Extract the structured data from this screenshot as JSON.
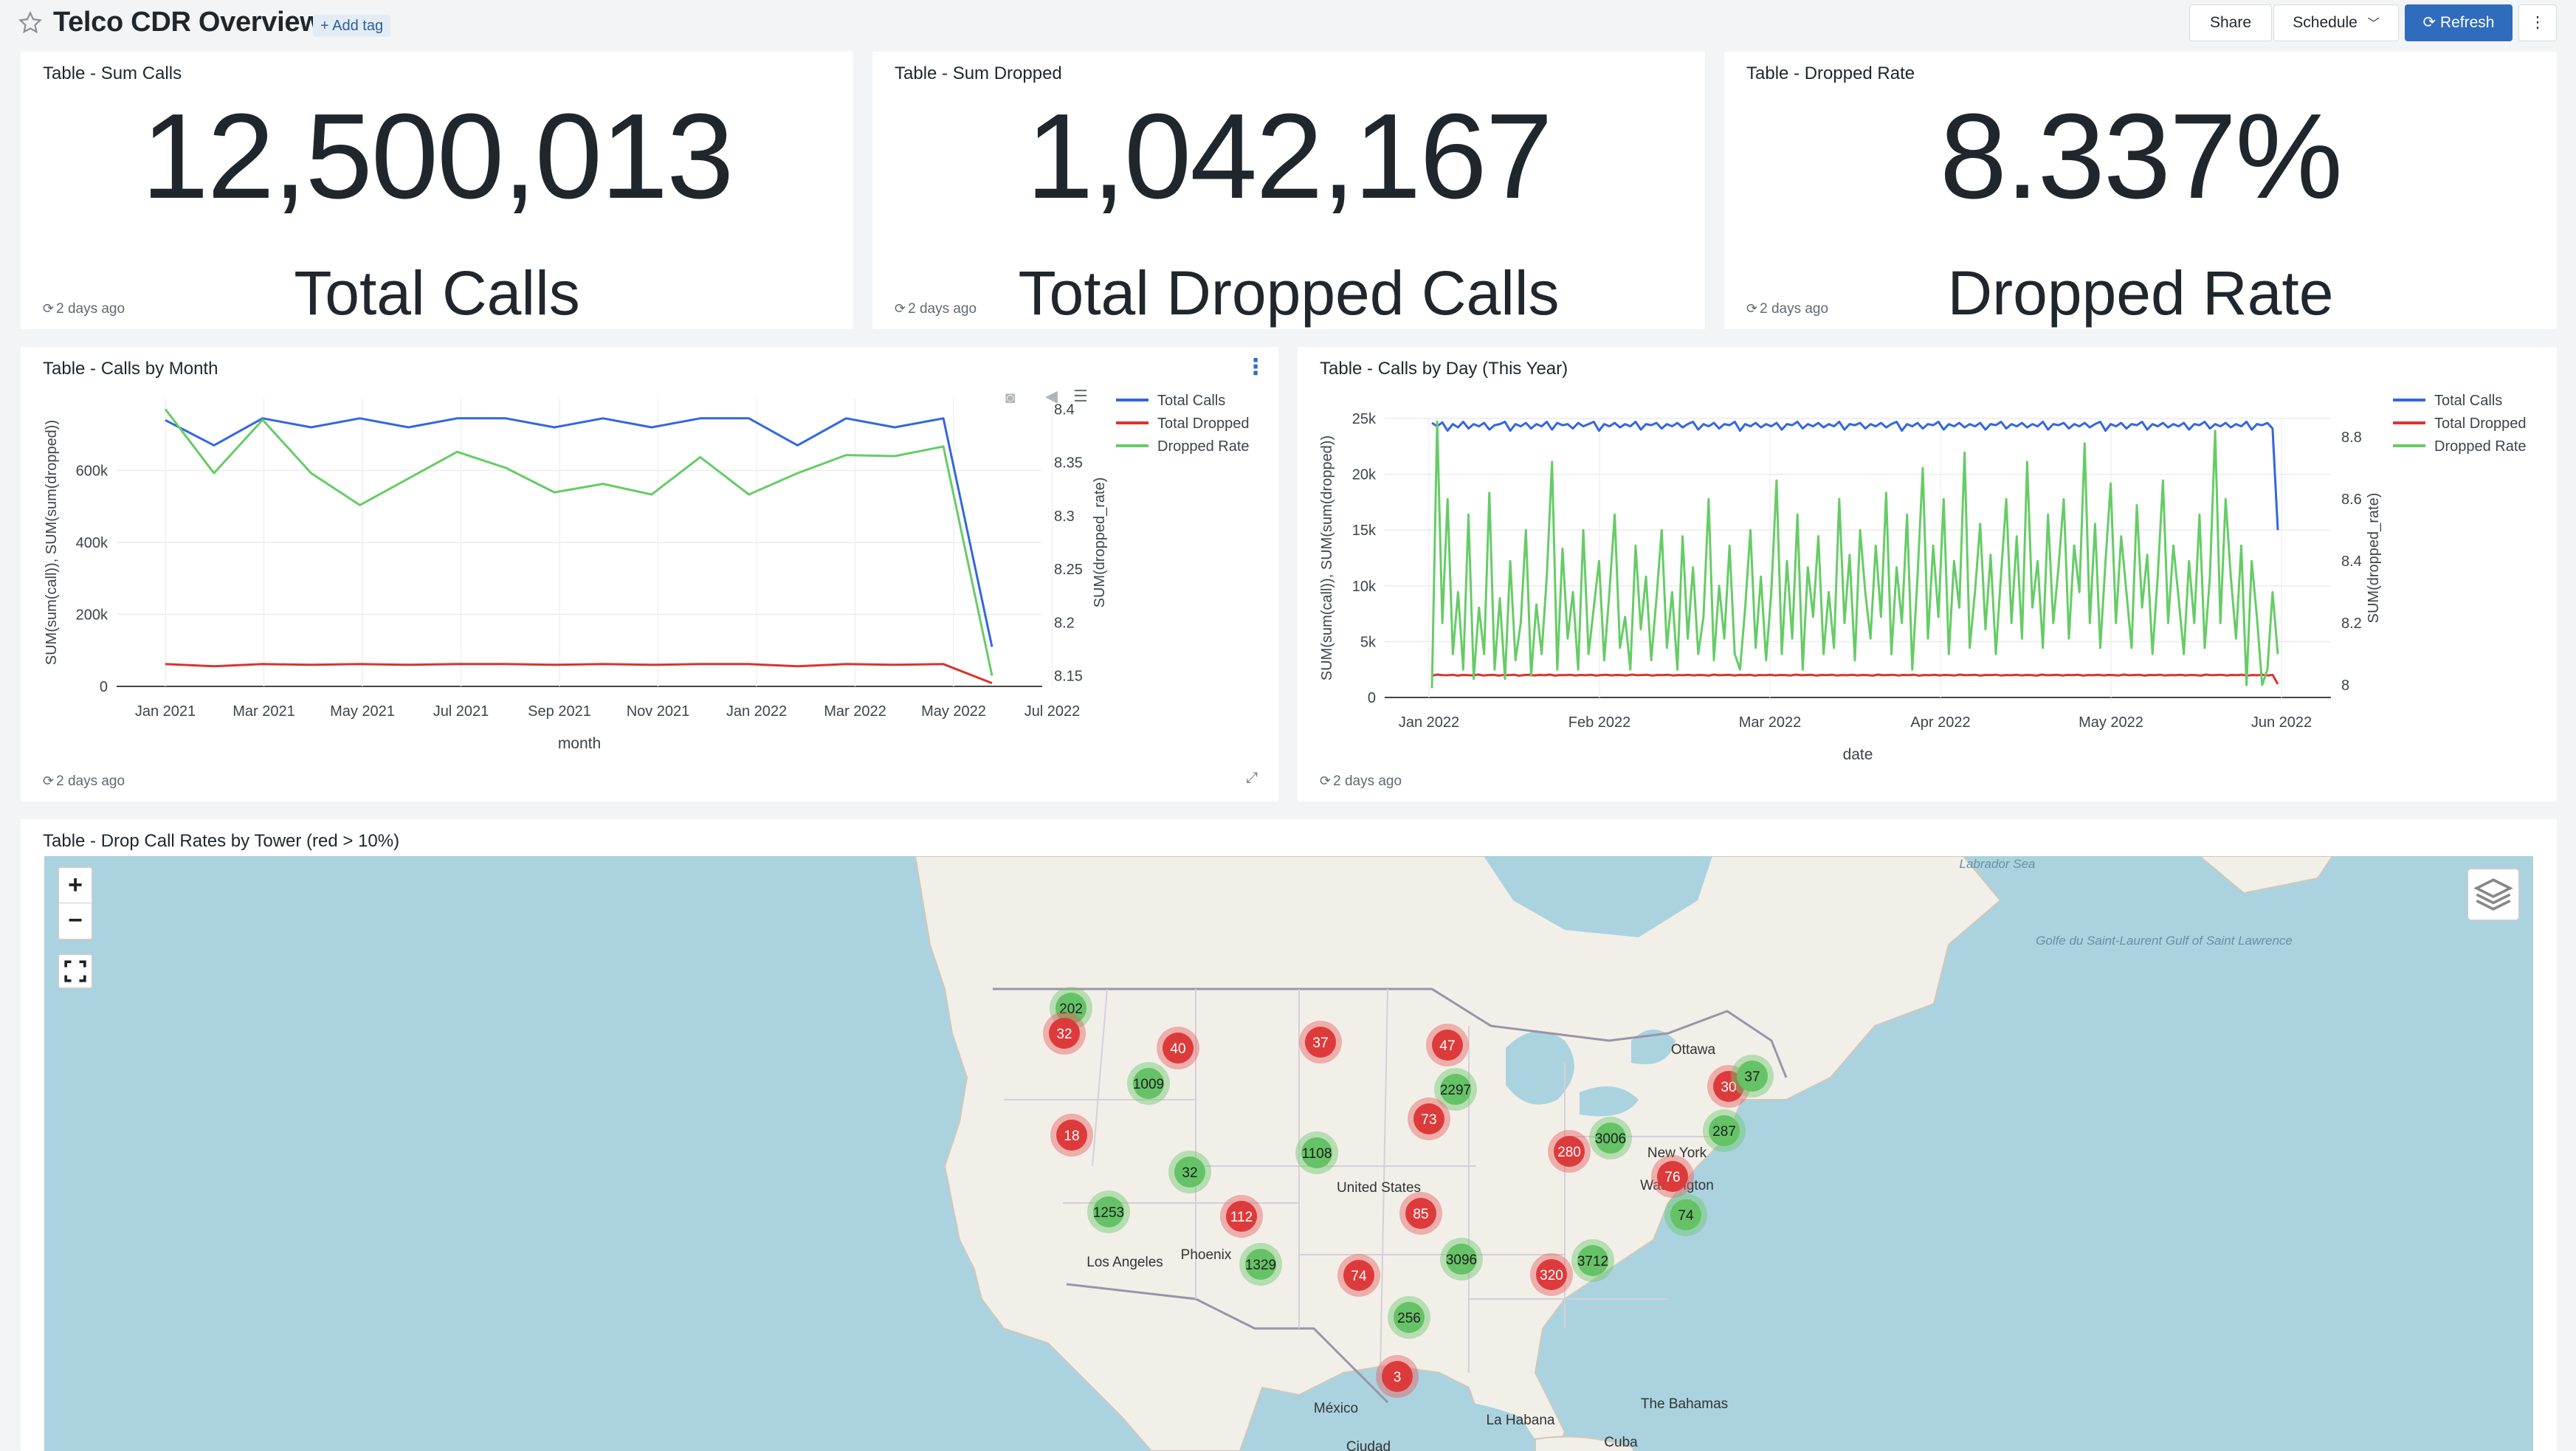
{
  "header": {
    "title": "Telco CDR Overview",
    "add_tag": "+ Add tag",
    "share": "Share",
    "schedule": "Schedule",
    "refresh": "Refresh",
    "more": "⋮"
  },
  "counters": [
    {
      "title": "Table - Sum Calls",
      "value": "12,500,013",
      "label": "Total Calls",
      "updated": "2 days ago"
    },
    {
      "title": "Table - Sum Dropped",
      "value": "1,042,167",
      "label": "Total Dropped Calls",
      "updated": "2 days ago"
    },
    {
      "title": "Table - Dropped Rate",
      "value": "8.337%",
      "label": "Dropped Rate",
      "updated": "2 days ago"
    }
  ],
  "colors": {
    "total_calls": "#3366e0",
    "total_dropped": "#db3330",
    "dropped_rate": "#66cc66",
    "accent": "#2f6cbd"
  },
  "chart_data": [
    {
      "type": "line",
      "title": "Table - Calls by Month",
      "xlabel": "month",
      "ylabel": "SUM(sum(call)), SUM(sum(dropped))",
      "y2label": "SUM(dropped_rate)",
      "updated": "2 days ago",
      "x_ticks": [
        "Jan 2021",
        "Mar 2021",
        "May 2021",
        "Jul 2021",
        "Sep 2021",
        "Nov 2021",
        "Jan 2022",
        "Mar 2022",
        "May 2022",
        "Jul 2022"
      ],
      "y_ticks": [
        "0",
        "200k",
        "400k",
        "600k"
      ],
      "y2_ticks": [
        "8.15",
        "8.2",
        "8.25",
        "8.3",
        "8.35",
        "8.4"
      ],
      "x": [
        "2021-01",
        "2021-02",
        "2021-03",
        "2021-04",
        "2021-05",
        "2021-06",
        "2021-07",
        "2021-08",
        "2021-09",
        "2021-10",
        "2021-11",
        "2021-12",
        "2022-01",
        "2022-02",
        "2022-03",
        "2022-04",
        "2022-05",
        "2022-06"
      ],
      "ylim": [
        0,
        800000
      ],
      "y2lim": [
        8.14,
        8.41
      ],
      "legend_position": "top-right",
      "series": [
        {
          "name": "Total Calls",
          "axis": "y",
          "values": [
            740000,
            670000,
            745000,
            720000,
            745000,
            720000,
            745000,
            745000,
            720000,
            745000,
            720000,
            745000,
            745000,
            670000,
            745000,
            720000,
            745000,
            110000
          ]
        },
        {
          "name": "Total Dropped",
          "axis": "y",
          "values": [
            62000,
            56000,
            62000,
            60000,
            62000,
            60000,
            62000,
            62000,
            60000,
            62000,
            60000,
            62000,
            62000,
            56000,
            62000,
            60000,
            62000,
            9000
          ]
        },
        {
          "name": "Dropped Rate",
          "axis": "y2",
          "values": [
            8.4,
            8.34,
            8.39,
            8.34,
            8.31,
            8.335,
            8.36,
            8.345,
            8.322,
            8.33,
            8.32,
            8.355,
            8.32,
            8.34,
            8.357,
            8.356,
            8.365,
            8.15
          ]
        }
      ]
    },
    {
      "type": "line",
      "title": "Table - Calls by Day (This Year)",
      "xlabel": "date",
      "ylabel": "SUM(sum(call)), SUM(sum(dropped))",
      "y2label": "SUM(dropped_rate)",
      "updated": "2 days ago",
      "x_ticks": [
        "Jan 2022",
        "Feb 2022",
        "Mar 2022",
        "Apr 2022",
        "May 2022",
        "Jun 2022"
      ],
      "y_ticks": [
        "0",
        "5k",
        "10k",
        "15k",
        "20k",
        "25k"
      ],
      "y2_ticks": [
        "8",
        "8.2",
        "8.4",
        "8.6",
        "8.8"
      ],
      "x_start": "2022-01-01",
      "x_end": "2022-06-09",
      "ylim": [
        0,
        25000
      ],
      "y2lim": [
        7.96,
        8.86
      ],
      "legend_position": "top-right",
      "series": [
        {
          "name": "Total Calls",
          "axis": "y",
          "values": [
            24600,
            24300,
            24650,
            23900,
            24500,
            24200,
            24700,
            24100,
            24500,
            24300,
            24600,
            24000,
            24400,
            24500,
            24700,
            23900,
            24500,
            24300,
            24600,
            24100,
            24500,
            24300,
            24700,
            24000,
            24600,
            24400,
            24500,
            24100,
            24600,
            24300,
            24500,
            24700,
            23900,
            24500,
            24300,
            24600,
            24200,
            24500,
            24300,
            24700,
            24000,
            24500,
            24400,
            24600,
            24100,
            24500,
            24300,
            24600,
            24200,
            24500,
            24700,
            24000,
            24500,
            24300,
            24600,
            24100,
            24500,
            24400,
            24700,
            23900,
            24500,
            24300,
            24600,
            24200,
            24500,
            24300,
            24600,
            24000,
            24500,
            24400,
            24700,
            24100,
            24500,
            24300,
            24600,
            24200,
            24500,
            24300,
            24700,
            24000,
            24500,
            24400,
            24600,
            24100,
            24500,
            24300,
            24600,
            24200,
            24500,
            24700,
            23900,
            24500,
            24300,
            24600,
            24100,
            24500,
            24400,
            24700,
            24000,
            24500,
            24300,
            24600,
            24200,
            24500,
            24300,
            24600,
            24000,
            24500,
            24400,
            24700,
            24100,
            24500,
            24300,
            24600,
            24200,
            24500,
            24300,
            24700,
            24000,
            24500,
            24400,
            24600,
            24100,
            24500,
            24300,
            24600,
            24200,
            24500,
            24700,
            23900,
            24500,
            24300,
            24600,
            24100,
            24500,
            24400,
            24700,
            24000,
            24500,
            24300,
            24600,
            24200,
            24500,
            24300,
            24600,
            24000,
            24500,
            24400,
            24700,
            24100,
            24500,
            24300,
            24600,
            24200,
            24500,
            24300,
            24700,
            24000,
            24500,
            24400,
            24600,
            24100,
            15000
          ]
        },
        {
          "name": "Total Dropped",
          "axis": "y",
          "values": [
            1950,
            2050,
            2000,
            1990,
            2040,
            1960,
            2020,
            2000,
            1980,
            2050,
            1970,
            2010,
            2030,
            1960,
            2020,
            2000,
            2040,
            1950,
            2010,
            2030,
            1980,
            2020,
            1990,
            2050,
            1960,
            2010,
            2000,
            2030,
            1970,
            2020,
            1990,
            2040,
            1960,
            2010,
            2030,
            1980,
            2020,
            2000,
            1970,
            2050,
            1990,
            2010,
            2030,
            1960,
            2020,
            2000,
            2040,
            1970,
            2010,
            1990,
            2030,
            1980,
            2020,
            2000,
            1960,
            2050,
            1990,
            2010,
            2030,
            1970,
            2020,
            2000,
            2040,
            1960,
            2010,
            1990,
            2030,
            1980,
            2020,
            2000,
            1970,
            2050,
            1990,
            2010,
            2030,
            1960,
            2020,
            2000,
            2040,
            1970,
            2010,
            1990,
            2030,
            1980,
            2020,
            2000,
            1960,
            2050,
            1990,
            2010,
            2030,
            1970,
            2020,
            2000,
            2040,
            1960,
            2010,
            1990,
            2030,
            1980,
            2020,
            2000,
            1970,
            2050,
            1990,
            2010,
            2030,
            1960,
            2020,
            2000,
            2040,
            1970,
            2010,
            1990,
            2030,
            1980,
            2020,
            2000,
            1960,
            2050,
            1990,
            2010,
            2030,
            1970,
            2020,
            2000,
            2040,
            1960,
            2010,
            1990,
            2030,
            1980,
            2020,
            2000,
            1970,
            2050,
            1990,
            2010,
            2030,
            1960,
            2020,
            2000,
            2040,
            1970,
            2010,
            1990,
            2030,
            1980,
            2020,
            2000,
            1960,
            2050,
            1990,
            2010,
            2030,
            1970,
            2020,
            2000,
            2040,
            1960,
            2010,
            1990,
            2030,
            1980,
            2020,
            1200
          ]
        },
        {
          "name": "Dropped Rate",
          "axis": "y2",
          "values": [
            7.99,
            8.85,
            8.2,
            8.6,
            8.1,
            8.3,
            8.05,
            8.55,
            8.02,
            8.25,
            8.1,
            8.62,
            8.05,
            8.28,
            8.02,
            8.4,
            8.08,
            8.2,
            8.5,
            8.03,
            8.26,
            8.1,
            8.35,
            8.72,
            8.05,
            8.44,
            8.15,
            8.3,
            8.05,
            8.5,
            8.1,
            8.25,
            8.4,
            8.08,
            8.3,
            8.55,
            8.12,
            8.22,
            8.05,
            8.45,
            8.18,
            8.35,
            8.08,
            8.28,
            8.5,
            8.12,
            8.3,
            8.05,
            8.48,
            8.15,
            8.38,
            8.1,
            8.22,
            8.6,
            8.08,
            8.32,
            8.15,
            8.45,
            8.1,
            8.05,
            8.25,
            8.5,
            8.12,
            8.35,
            8.08,
            8.3,
            8.66,
            8.1,
            8.4,
            8.15,
            8.55,
            8.05,
            8.38,
            8.22,
            8.48,
            8.1,
            8.3,
            8.12,
            8.6,
            8.2,
            8.42,
            8.08,
            8.5,
            8.3,
            8.15,
            8.45,
            8.22,
            8.62,
            8.1,
            8.38,
            8.2,
            8.55,
            8.05,
            8.35,
            8.7,
            8.15,
            8.45,
            8.22,
            8.6,
            8.1,
            8.4,
            8.25,
            8.75,
            8.12,
            8.3,
            8.52,
            8.18,
            8.42,
            8.1,
            8.36,
            8.6,
            8.2,
            8.48,
            8.15,
            8.72,
            8.25,
            8.4,
            8.12,
            8.55,
            8.2,
            8.38,
            8.6,
            8.15,
            8.45,
            8.3,
            8.78,
            8.2,
            8.52,
            8.12,
            8.4,
            8.65,
            8.2,
            8.48,
            8.3,
            8.12,
            8.58,
            8.25,
            8.42,
            8.1,
            8.35,
            8.66,
            8.2,
            8.45,
            8.28,
            8.1,
            8.4,
            8.2,
            8.55,
            8.12,
            8.35,
            8.82,
            8.2,
            8.6,
            8.35,
            8.15,
            8.45,
            8.0,
            8.4,
            8.22,
            8.0,
            8.05,
            8.3,
            8.1
          ]
        }
      ]
    }
  ],
  "map": {
    "title": "Table - Drop Call Rates by Tower (red > 10%)",
    "zoom_in": "+",
    "zoom_out": "−",
    "place_labels": [
      "Ottawa",
      "New York",
      "Washington",
      "United States",
      "Los Angeles",
      "Phoenix",
      "México",
      "La Habana",
      "The Bahamas",
      "Cuba",
      "Ciudad",
      "Labrador Sea",
      "Golfe du Saint-Laurent Gulf of Saint Lawrence"
    ],
    "clusters": [
      {
        "count": "202",
        "status": "green"
      },
      {
        "count": "32",
        "status": "red"
      },
      {
        "count": "40",
        "status": "red"
      },
      {
        "count": "1009",
        "status": "green"
      },
      {
        "count": "37",
        "status": "red"
      },
      {
        "count": "47",
        "status": "red"
      },
      {
        "count": "2297",
        "status": "green"
      },
      {
        "count": "73",
        "status": "red"
      },
      {
        "count": "18",
        "status": "red"
      },
      {
        "count": "32",
        "status": "green"
      },
      {
        "count": "1108",
        "status": "green"
      },
      {
        "count": "1253",
        "status": "green"
      },
      {
        "count": "112",
        "status": "red"
      },
      {
        "count": "85",
        "status": "red"
      },
      {
        "count": "1329",
        "status": "green"
      },
      {
        "count": "74",
        "status": "red"
      },
      {
        "count": "3096",
        "status": "green"
      },
      {
        "count": "256",
        "status": "green"
      },
      {
        "count": "3",
        "status": "red"
      },
      {
        "count": "320",
        "status": "red"
      },
      {
        "count": "3712",
        "status": "green"
      },
      {
        "count": "280",
        "status": "red"
      },
      {
        "count": "3006",
        "status": "green"
      },
      {
        "count": "76",
        "status": "red"
      },
      {
        "count": "74",
        "status": "green"
      },
      {
        "count": "287",
        "status": "green"
      },
      {
        "count": "30",
        "status": "red"
      },
      {
        "count": "37",
        "status": "green"
      }
    ]
  }
}
